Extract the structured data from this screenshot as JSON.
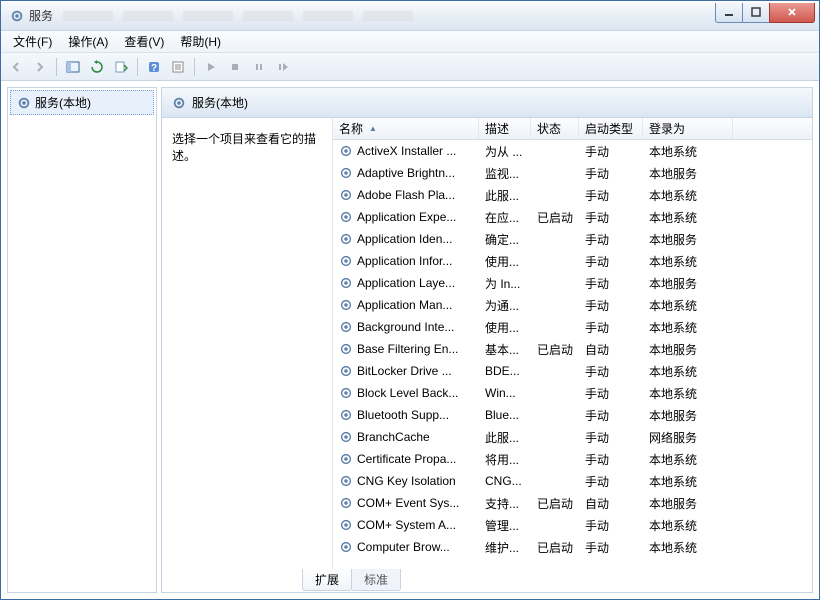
{
  "window": {
    "title": "服务"
  },
  "menu": {
    "file": "文件(F)",
    "action": "操作(A)",
    "view": "查看(V)",
    "help": "帮助(H)"
  },
  "tree": {
    "root": "服务(本地)"
  },
  "header": {
    "title": "服务(本地)"
  },
  "desc": {
    "prompt": "选择一个项目来查看它的描述。"
  },
  "columns": {
    "name": "名称",
    "description": "描述",
    "status": "状态",
    "startup": "启动类型",
    "logon": "登录为"
  },
  "tabs": {
    "extended": "扩展",
    "standard": "标准"
  },
  "services": [
    {
      "name": "ActiveX Installer ...",
      "desc": "为从 ...",
      "status": "",
      "startup": "手动",
      "logon": "本地系统"
    },
    {
      "name": "Adaptive Brightn...",
      "desc": "监视...",
      "status": "",
      "startup": "手动",
      "logon": "本地服务"
    },
    {
      "name": "Adobe Flash Pla...",
      "desc": "此服...",
      "status": "",
      "startup": "手动",
      "logon": "本地系统"
    },
    {
      "name": "Application Expe...",
      "desc": "在应...",
      "status": "已启动",
      "startup": "手动",
      "logon": "本地系统"
    },
    {
      "name": "Application Iden...",
      "desc": "确定...",
      "status": "",
      "startup": "手动",
      "logon": "本地服务"
    },
    {
      "name": "Application Infor...",
      "desc": "使用...",
      "status": "",
      "startup": "手动",
      "logon": "本地系统"
    },
    {
      "name": "Application Laye...",
      "desc": "为 In...",
      "status": "",
      "startup": "手动",
      "logon": "本地服务"
    },
    {
      "name": "Application Man...",
      "desc": "为通...",
      "status": "",
      "startup": "手动",
      "logon": "本地系统"
    },
    {
      "name": "Background Inte...",
      "desc": "使用...",
      "status": "",
      "startup": "手动",
      "logon": "本地系统"
    },
    {
      "name": "Base Filtering En...",
      "desc": "基本...",
      "status": "已启动",
      "startup": "自动",
      "logon": "本地服务"
    },
    {
      "name": "BitLocker Drive ...",
      "desc": "BDE...",
      "status": "",
      "startup": "手动",
      "logon": "本地系统"
    },
    {
      "name": "Block Level Back...",
      "desc": "Win...",
      "status": "",
      "startup": "手动",
      "logon": "本地系统"
    },
    {
      "name": "Bluetooth Supp...",
      "desc": "Blue...",
      "status": "",
      "startup": "手动",
      "logon": "本地服务"
    },
    {
      "name": "BranchCache",
      "desc": "此服...",
      "status": "",
      "startup": "手动",
      "logon": "网络服务"
    },
    {
      "name": "Certificate Propa...",
      "desc": "将用...",
      "status": "",
      "startup": "手动",
      "logon": "本地系统"
    },
    {
      "name": "CNG Key Isolation",
      "desc": "CNG...",
      "status": "",
      "startup": "手动",
      "logon": "本地系统"
    },
    {
      "name": "COM+ Event Sys...",
      "desc": "支持...",
      "status": "已启动",
      "startup": "自动",
      "logon": "本地服务"
    },
    {
      "name": "COM+ System A...",
      "desc": "管理...",
      "status": "",
      "startup": "手动",
      "logon": "本地系统"
    },
    {
      "name": "Computer Brow...",
      "desc": "维护...",
      "status": "已启动",
      "startup": "手动",
      "logon": "本地系统"
    }
  ]
}
